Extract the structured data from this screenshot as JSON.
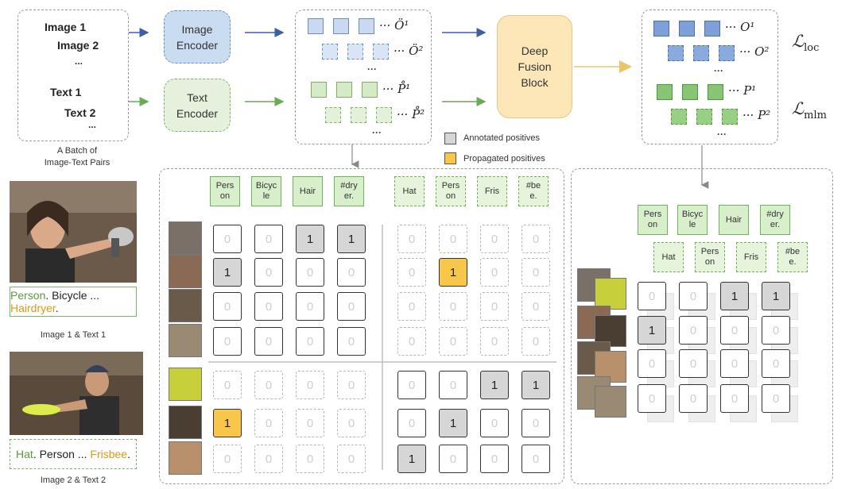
{
  "batch": {
    "image1": "Image 1",
    "image2": "Image 2",
    "text1": "Text 1",
    "text2": "Text 2",
    "ellipsis": "...",
    "caption_line1": "A Batch of",
    "caption_line2": "Image-Text Pairs"
  },
  "encoders": {
    "image_line1": "Image",
    "image_line2": "Encoder",
    "text_line1": "Text",
    "text_line2": "Encoder"
  },
  "features": {
    "o1": "··· Ö¹",
    "o2": "··· Ö²",
    "p1": "··· P̊¹",
    "p2": "··· P̊²",
    "dots": "···"
  },
  "fusion": {
    "line1": "Deep",
    "line2": "Fusion",
    "line3": "Block"
  },
  "outputs": {
    "o1": "··· O¹",
    "o2": "··· O²",
    "p1": "··· P¹",
    "p2": "··· P²",
    "dots": "···"
  },
  "losses": {
    "loc_symbol": "ℒ",
    "loc_sub": "loc",
    "mlm_symbol": "ℒ",
    "mlm_sub": "mlm"
  },
  "legend": {
    "annotated": "Annotated positives",
    "propagated": "Propagated positives"
  },
  "left_examples": {
    "caption1": {
      "a": "Person",
      "b": ". Bicycle ... ",
      "c": "Hairdryer",
      "d": "."
    },
    "label1": "Image 1 & Text 1",
    "caption2": {
      "a": "Hat",
      "b": ". Person ... ",
      "c": "Frisbee",
      "d": "."
    },
    "label2": "Image 2 & Text 2"
  },
  "matrix": {
    "tags_text1": [
      "Pers\non",
      "Bicyc\nle",
      "Hair",
      "#dry\ner."
    ],
    "tags_text2": [
      "Hat",
      "Pers\non",
      "Fris",
      "#be\ne."
    ],
    "rows": [
      [
        "0",
        "0",
        "1",
        "1",
        "0",
        "0",
        "0",
        "0"
      ],
      [
        "1",
        "0",
        "0",
        "0",
        "0",
        "1",
        "0",
        "0"
      ],
      [
        "0",
        "0",
        "0",
        "0",
        "0",
        "0",
        "0",
        "0"
      ],
      [
        "0",
        "0",
        "0",
        "0",
        "0",
        "0",
        "0",
        "0"
      ],
      [
        "0",
        "0",
        "0",
        "0",
        "0",
        "0",
        "1",
        "1"
      ],
      [
        "1",
        "0",
        "0",
        "0",
        "0",
        "1",
        "0",
        "0"
      ],
      [
        "0",
        "0",
        "0",
        "0",
        "1",
        "0",
        "0",
        "0"
      ]
    ],
    "state": [
      [
        "n",
        "n",
        "a",
        "a",
        "n",
        "n",
        "n",
        "n"
      ],
      [
        "a",
        "n",
        "n",
        "n",
        "n",
        "p",
        "n",
        "n"
      ],
      [
        "n",
        "n",
        "n",
        "n",
        "n",
        "n",
        "n",
        "n"
      ],
      [
        "n",
        "n",
        "n",
        "n",
        "n",
        "n",
        "n",
        "n"
      ],
      [
        "n",
        "n",
        "n",
        "n",
        "n",
        "n",
        "a",
        "a"
      ],
      [
        "p",
        "n",
        "n",
        "n",
        "n",
        "a",
        "n",
        "n"
      ],
      [
        "n",
        "n",
        "n",
        "n",
        "a",
        "n",
        "n",
        "n"
      ]
    ]
  },
  "right_matrix": {
    "tags_text1": [
      "Pers\non",
      "Bicyc\nle",
      "Hair",
      "#dry\ner."
    ],
    "tags_text2": [
      "Hat",
      "Pers\non",
      "Fris",
      "#be\ne."
    ],
    "rows": [
      [
        "0",
        "0",
        "1",
        "1"
      ],
      [
        "1",
        "0",
        "0",
        "0"
      ],
      [
        "0",
        "0",
        "0",
        "0"
      ],
      [
        "0",
        "0",
        "0",
        "0"
      ]
    ],
    "state": [
      [
        "n",
        "n",
        "a",
        "a"
      ],
      [
        "a",
        "n",
        "n",
        "n"
      ],
      [
        "n",
        "n",
        "n",
        "n"
      ],
      [
        "n",
        "n",
        "n",
        "n"
      ]
    ]
  },
  "colors": {
    "blue_arrow": "#3d5fa8",
    "green_arrow": "#6aab55",
    "yellow_arrow": "#f2d48a",
    "annotated": "#d6d6d6",
    "propagated": "#f8c74a"
  }
}
